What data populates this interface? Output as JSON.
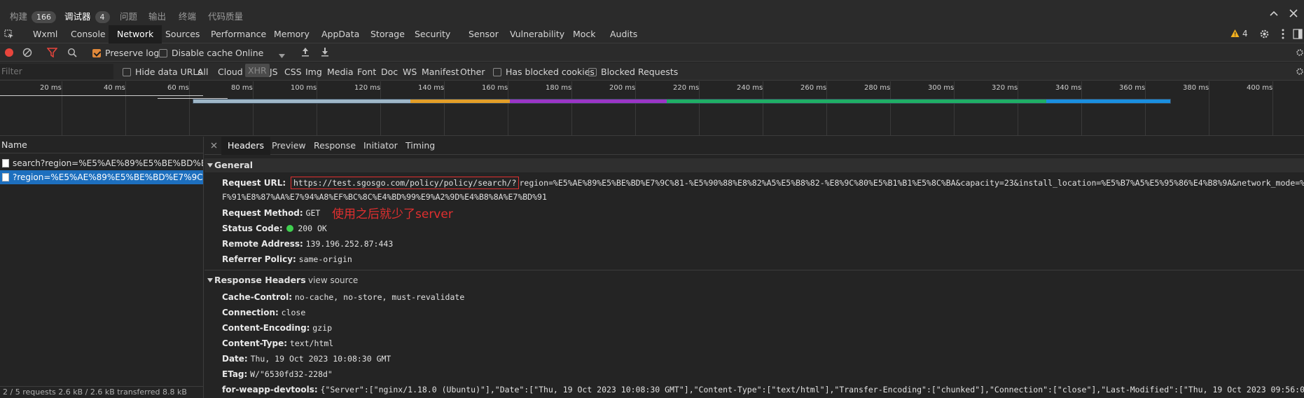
{
  "top_tabs": [
    {
      "label": "构建",
      "badge": "166"
    },
    {
      "label": "调试器",
      "badge": "4"
    },
    {
      "label": "问题"
    },
    {
      "label": "输出"
    },
    {
      "label": "终端"
    },
    {
      "label": "代码质量"
    }
  ],
  "devtools_tabs": [
    "Wxml",
    "Console",
    "Network",
    "Sources",
    "Performance",
    "Memory",
    "AppData",
    "Storage",
    "Security",
    "Sensor",
    "Vulnerability",
    "Mock",
    "Audits"
  ],
  "active_devtools_tab": "Network",
  "warning_count": "4",
  "toolbar": {
    "preserve_log": "Preserve log",
    "disable_cache": "Disable cache",
    "throttle": "Online"
  },
  "filter": {
    "placeholder": "Filter",
    "hide_data_urls": "Hide data URLs",
    "types": [
      "All",
      "Cloud",
      "XHR",
      "JS",
      "CSS",
      "Img",
      "Media",
      "Font",
      "Doc",
      "WS",
      "Manifest",
      "Other"
    ],
    "has_blocked_cookies": "Has blocked cookies",
    "blocked_requests": "Blocked Requests"
  },
  "timeline_ticks": [
    "20 ms",
    "40 ms",
    "60 ms",
    "80 ms",
    "100 ms",
    "120 ms",
    "140 ms",
    "160 ms",
    "180 ms",
    "200 ms",
    "220 ms",
    "240 ms",
    "260 ms",
    "280 ms",
    "300 ms",
    "320 ms",
    "340 ms",
    "360 ms",
    "380 ms",
    "400 ms"
  ],
  "colors": {
    "waterfall_queue": "#9fb7c8",
    "waterfall_wait": "#e39e28",
    "waterfall_ssl": "#9b35c6",
    "waterfall_download": "#1fae65",
    "waterfall_receive": "#1a8fe0",
    "selected_row": "#1d6fbe",
    "annotation_red": "#e02f2f",
    "status_green": "#3fcf4f"
  },
  "requests": {
    "header": "Name",
    "rows": [
      "search?region=%E5%AE%89%E5%BE%BD%E7%9C%81-%E5%90%88...",
      "?region=%E5%AE%89%E5%BE%BD%E7%9C%81-%E5%90%88%E8..."
    ],
    "summary": "2 / 5 requests    2.6 kB / 2.6 kB transferred    8.8 kB"
  },
  "detail_tabs": [
    "Headers",
    "Preview",
    "Response",
    "Initiator",
    "Timing"
  ],
  "general": {
    "title": "General",
    "request_url_label": "Request URL:",
    "request_url_boxed": "https://test.sgosgo.com/policy/policy/search/?",
    "request_url_rest1": "region=%E5%AE%89%E5%BE%BD%E7%9C%81-%E5%90%88%E8%82%A5%E5%B8%82-%E8%9C%80%E5%B1%B1%E5%8C%BA&capacity=23&install_location=%E5%B7%A5%E5%95%86%E4%B8%9A&network_mode=%E8%87%AA%E5%8",
    "request_url_rest2": "F%91%E8%87%AA%E7%94%A8%EF%BC%8C%E4%BD%99%E9%A2%9D%E4%B8%8A%E7%BD%91",
    "method_label": "Request Method:",
    "method": "GET",
    "status_label": "Status Code:",
    "status": "200 OK",
    "remote_label": "Remote Address:",
    "remote": "139.196.252.87:443",
    "referrer_label": "Referrer Policy:",
    "referrer": "same-origin"
  },
  "annotation": "使用之后就少了server",
  "response_headers": {
    "title": "Response Headers",
    "view_source": "view source",
    "items": [
      {
        "k": "Cache-Control:",
        "v": "no-cache, no-store, must-revalidate"
      },
      {
        "k": "Connection:",
        "v": "close"
      },
      {
        "k": "Content-Encoding:",
        "v": "gzip"
      },
      {
        "k": "Content-Type:",
        "v": "text/html"
      },
      {
        "k": "Date:",
        "v": "Thu, 19 Oct 2023 10:08:30 GMT"
      },
      {
        "k": "ETag:",
        "v": "W/\"6530fd32-228d\""
      },
      {
        "k": "for-weapp-devtools:",
        "v": "{\"Server\":[\"nginx/1.18.0 (Ubuntu)\"],\"Date\":[\"Thu, 19 Oct 2023 10:08:30 GMT\"],\"Content-Type\":[\"text/html\"],\"Transfer-Encoding\":[\"chunked\"],\"Connection\":[\"close\"],\"Last-Modified\":[\"Thu, 19 Oct 2023 09:56:02 GMT\"],\"Var"
      }
    ]
  }
}
